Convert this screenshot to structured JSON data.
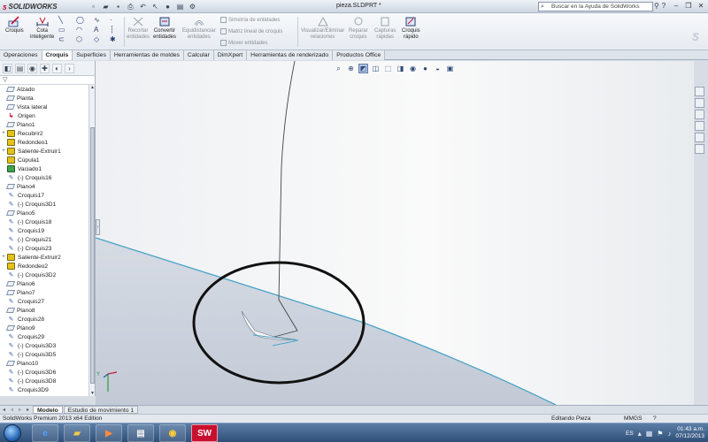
{
  "app": {
    "brand_logo": "SOLIDWORKS",
    "document_title": "pieza.SLDPRT *",
    "help_search_placeholder": "Buscar en la Ayuda de SolidWorks"
  },
  "ribbon": {
    "croquis": "Croquis",
    "cota_1": "Cota",
    "cota_2": "inteligente",
    "recortar_1": "Recortar",
    "recortar_2": "entidades",
    "convertir_1": "Convertir",
    "convertir_2": "entidades",
    "equidistanciar_1": "Equidistanciar",
    "equidistanciar_2": "entidades",
    "simetria": "Simetría de entidades",
    "matriz": "Matriz lineal de croquis",
    "mover": "Mover entidades",
    "relaciones_1": "Visualizar/Eliminar",
    "relaciones_2": "relaciones",
    "reparar_1": "Reparar",
    "reparar_2": "croquis",
    "capturas_1": "Capturas",
    "capturas_2": "rápidas",
    "croquis_rapido_1": "Croquis",
    "croquis_rapido_2": "rápido"
  },
  "tabs": [
    {
      "label": "Operaciones"
    },
    {
      "label": "Croquis"
    },
    {
      "label": "Superficies"
    },
    {
      "label": "Herramientas de moldes"
    },
    {
      "label": "Calcular"
    },
    {
      "label": "DimXpert"
    },
    {
      "label": "Herramientas de renderizado"
    },
    {
      "label": "Productos Office"
    }
  ],
  "feature_tree": [
    {
      "label": "Alzado",
      "icon": "plane-icon"
    },
    {
      "label": "Planta",
      "icon": "plane-icon"
    },
    {
      "label": "Vista lateral",
      "icon": "plane-icon"
    },
    {
      "label": "Origen",
      "icon": "origin-icon"
    },
    {
      "label": "Plano1",
      "icon": "plane-icon"
    },
    {
      "label": "Recubrir2",
      "icon": "loft-icon",
      "expand": "+"
    },
    {
      "label": "Redondeo1",
      "icon": "fillet-icon"
    },
    {
      "label": "Saliente-Extruir1",
      "icon": "extrude-icon",
      "expand": "+"
    },
    {
      "label": "Cúpula1",
      "icon": "dome-icon"
    },
    {
      "label": "Vaciado1",
      "icon": "shell-icon"
    },
    {
      "label": "(-) Croquis16",
      "icon": "sketch-icon"
    },
    {
      "label": "Plano4",
      "icon": "plane-icon"
    },
    {
      "label": "Croquis17",
      "icon": "sketch-icon"
    },
    {
      "label": "(-) Croquis3D1",
      "icon": "sketch-icon"
    },
    {
      "label": "Plano5",
      "icon": "plane-icon"
    },
    {
      "label": "(-) Croquis18",
      "icon": "sketch-icon"
    },
    {
      "label": "Croquis19",
      "icon": "sketch-icon"
    },
    {
      "label": "(-) Croquis21",
      "icon": "sketch-icon"
    },
    {
      "label": "(-) Croquis23",
      "icon": "sketch-icon"
    },
    {
      "label": "Saliente-Extruir2",
      "icon": "extrude-icon",
      "expand": "+"
    },
    {
      "label": "Redondeo2",
      "icon": "fillet-icon"
    },
    {
      "label": "(-) Croquis3D2",
      "icon": "sketch-icon"
    },
    {
      "label": "Plano6",
      "icon": "plane-icon"
    },
    {
      "label": "Plano7",
      "icon": "plane-icon"
    },
    {
      "label": "Croquis27",
      "icon": "sketch-icon"
    },
    {
      "label": "Plano8",
      "icon": "plane-icon"
    },
    {
      "label": "Croquis28",
      "icon": "sketch-icon"
    },
    {
      "label": "Plano9",
      "icon": "plane-icon"
    },
    {
      "label": "Croquis29",
      "icon": "sketch-icon"
    },
    {
      "label": "(-) Croquis3D3",
      "icon": "sketch-icon"
    },
    {
      "label": "(-) Croquis3D5",
      "icon": "sketch-icon"
    },
    {
      "label": "Plano10",
      "icon": "plane-icon"
    },
    {
      "label": "(-) Croquis3D6",
      "icon": "sketch-icon"
    },
    {
      "label": "(-) Croquis3D8",
      "icon": "sketch-icon"
    },
    {
      "label": "Croquis3D9",
      "icon": "sketch-icon"
    }
  ],
  "bottom_tabs": {
    "modelo": "Modelo",
    "estudio": "Estudio de movimiento 1"
  },
  "status": {
    "edition": "SolidWorks Premium 2013 x64 Edition",
    "mode": "Editando Pieza",
    "units": "MMGS",
    "help": "?"
  },
  "taskbar": {
    "language": "ES",
    "time": "01:43 a.m.",
    "date": "07/12/2013",
    "solidworks_app_label": "SW"
  },
  "colors": {
    "viewport_bg": "#f4f4f5",
    "part_face": "#c9cfda",
    "part_edge": "#4aa3c8",
    "annotation_ellipse": "#111111"
  }
}
